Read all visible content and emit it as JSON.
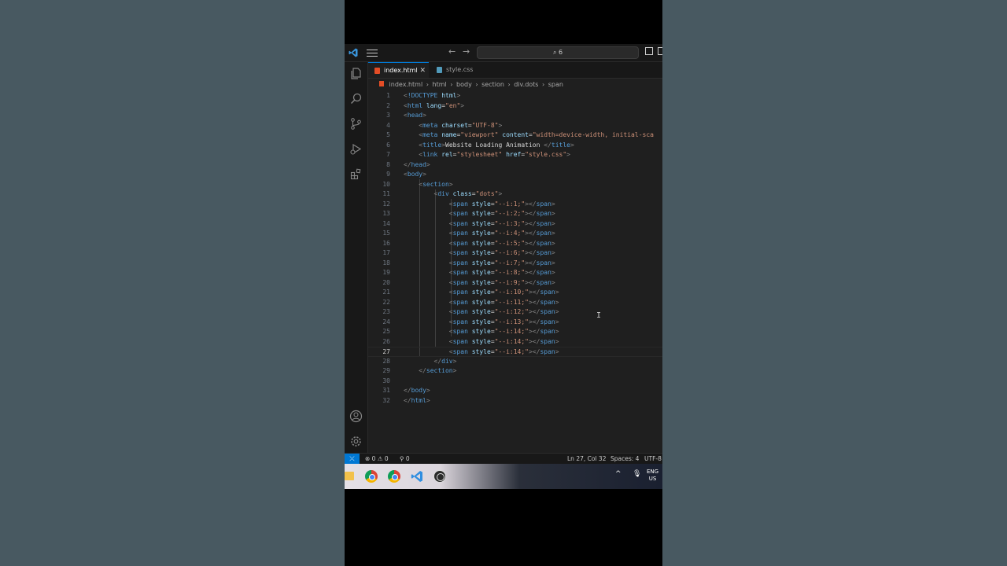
{
  "titlebar": {
    "search_text": "⌕ 6",
    "back_icon": "arrow-left-icon",
    "forward_icon": "arrow-right-icon"
  },
  "tabs": [
    {
      "label": "index.html",
      "active": true,
      "icon": "html5-icon",
      "icon_color": "#e44d26"
    },
    {
      "label": "style.css",
      "active": false,
      "icon": "css3-icon",
      "icon_color": "#519aba"
    }
  ],
  "breadcrumb": [
    "index.html",
    "html",
    "body",
    "section",
    "div.dots",
    "span"
  ],
  "editor": {
    "lines": [
      {
        "n": "1",
        "tokens": [
          [
            "t-punct",
            "<"
          ],
          [
            "t-doc",
            "!DOCTYPE"
          ],
          [
            "t-text",
            " "
          ],
          [
            "t-attr",
            "html"
          ],
          [
            "t-punct",
            ">"
          ]
        ]
      },
      {
        "n": "2",
        "tokens": [
          [
            "t-punct",
            "<"
          ],
          [
            "t-tag",
            "html"
          ],
          [
            "t-text",
            " "
          ],
          [
            "t-attr",
            "lang"
          ],
          [
            "t-text",
            "="
          ],
          [
            "t-str",
            "\"en\""
          ],
          [
            "t-punct",
            ">"
          ]
        ]
      },
      {
        "n": "3",
        "tokens": [
          [
            "t-punct",
            "<"
          ],
          [
            "t-tag",
            "head"
          ],
          [
            "t-punct",
            ">"
          ]
        ]
      },
      {
        "n": "4",
        "tokens": [
          [
            "t-text",
            "    "
          ],
          [
            "t-punct",
            "<"
          ],
          [
            "t-tag",
            "meta"
          ],
          [
            "t-text",
            " "
          ],
          [
            "t-attr",
            "charset"
          ],
          [
            "t-text",
            "="
          ],
          [
            "t-str",
            "\"UTF-8\""
          ],
          [
            "t-punct",
            ">"
          ]
        ]
      },
      {
        "n": "5",
        "tokens": [
          [
            "t-text",
            "    "
          ],
          [
            "t-punct",
            "<"
          ],
          [
            "t-tag",
            "meta"
          ],
          [
            "t-text",
            " "
          ],
          [
            "t-attr",
            "name"
          ],
          [
            "t-text",
            "="
          ],
          [
            "t-str",
            "\"viewport\""
          ],
          [
            "t-text",
            " "
          ],
          [
            "t-attr",
            "content"
          ],
          [
            "t-text",
            "="
          ],
          [
            "t-str",
            "\"width=device-width, initial-sca"
          ]
        ]
      },
      {
        "n": "6",
        "tokens": [
          [
            "t-text",
            "    "
          ],
          [
            "t-punct",
            "<"
          ],
          [
            "t-tag",
            "title"
          ],
          [
            "t-punct",
            ">"
          ],
          [
            "t-text",
            "Website Loading Animation "
          ],
          [
            "t-punct",
            "</"
          ],
          [
            "t-tag",
            "title"
          ],
          [
            "t-punct",
            ">"
          ]
        ]
      },
      {
        "n": "7",
        "tokens": [
          [
            "t-text",
            "    "
          ],
          [
            "t-punct",
            "<"
          ],
          [
            "t-tag",
            "link"
          ],
          [
            "t-text",
            " "
          ],
          [
            "t-attr",
            "rel"
          ],
          [
            "t-text",
            "="
          ],
          [
            "t-str",
            "\"stylesheet\""
          ],
          [
            "t-text",
            " "
          ],
          [
            "t-attr",
            "href"
          ],
          [
            "t-text",
            "="
          ],
          [
            "t-str",
            "\"style.css\""
          ],
          [
            "t-punct",
            ">"
          ]
        ]
      },
      {
        "n": "8",
        "tokens": [
          [
            "t-punct",
            "</"
          ],
          [
            "t-tag",
            "head"
          ],
          [
            "t-punct",
            ">"
          ]
        ]
      },
      {
        "n": "9",
        "tokens": [
          [
            "t-punct",
            "<"
          ],
          [
            "t-tag",
            "body"
          ],
          [
            "t-punct",
            ">"
          ]
        ]
      },
      {
        "n": "10",
        "tokens": [
          [
            "t-text",
            "    "
          ],
          [
            "t-punct",
            "<"
          ],
          [
            "t-tag",
            "section"
          ],
          [
            "t-punct",
            ">"
          ]
        ]
      },
      {
        "n": "11",
        "tokens": [
          [
            "t-text",
            "        "
          ],
          [
            "t-punct",
            "<"
          ],
          [
            "t-tag",
            "div"
          ],
          [
            "t-text",
            " "
          ],
          [
            "t-attr",
            "class"
          ],
          [
            "t-text",
            "="
          ],
          [
            "t-str",
            "\"dots\""
          ],
          [
            "t-punct",
            ">"
          ]
        ]
      },
      {
        "n": "12",
        "tokens": [
          [
            "t-text",
            "            "
          ],
          [
            "t-punct",
            "<"
          ],
          [
            "t-tag",
            "span"
          ],
          [
            "t-text",
            " "
          ],
          [
            "t-attr",
            "style"
          ],
          [
            "t-text",
            "="
          ],
          [
            "t-str",
            "\"--i:1;\""
          ],
          [
            "t-punct",
            "></"
          ],
          [
            "t-tag",
            "span"
          ],
          [
            "t-punct",
            ">"
          ]
        ]
      },
      {
        "n": "13",
        "tokens": [
          [
            "t-text",
            "            "
          ],
          [
            "t-punct",
            "<"
          ],
          [
            "t-tag",
            "span"
          ],
          [
            "t-text",
            " "
          ],
          [
            "t-attr",
            "style"
          ],
          [
            "t-text",
            "="
          ],
          [
            "t-str",
            "\"--i:2;\""
          ],
          [
            "t-punct",
            "></"
          ],
          [
            "t-tag",
            "span"
          ],
          [
            "t-punct",
            ">"
          ]
        ]
      },
      {
        "n": "14",
        "tokens": [
          [
            "t-text",
            "            "
          ],
          [
            "t-punct",
            "<"
          ],
          [
            "t-tag",
            "span"
          ],
          [
            "t-text",
            " "
          ],
          [
            "t-attr",
            "style"
          ],
          [
            "t-text",
            "="
          ],
          [
            "t-str",
            "\"--i:3;\""
          ],
          [
            "t-punct",
            "></"
          ],
          [
            "t-tag",
            "span"
          ],
          [
            "t-punct",
            ">"
          ]
        ]
      },
      {
        "n": "15",
        "tokens": [
          [
            "t-text",
            "            "
          ],
          [
            "t-punct",
            "<"
          ],
          [
            "t-tag",
            "span"
          ],
          [
            "t-text",
            " "
          ],
          [
            "t-attr",
            "style"
          ],
          [
            "t-text",
            "="
          ],
          [
            "t-str",
            "\"--i:4;\""
          ],
          [
            "t-punct",
            "></"
          ],
          [
            "t-tag",
            "span"
          ],
          [
            "t-punct",
            ">"
          ]
        ]
      },
      {
        "n": "16",
        "tokens": [
          [
            "t-text",
            "            "
          ],
          [
            "t-punct",
            "<"
          ],
          [
            "t-tag",
            "span"
          ],
          [
            "t-text",
            " "
          ],
          [
            "t-attr",
            "style"
          ],
          [
            "t-text",
            "="
          ],
          [
            "t-str",
            "\"--i:5;\""
          ],
          [
            "t-punct",
            "></"
          ],
          [
            "t-tag",
            "span"
          ],
          [
            "t-punct",
            ">"
          ]
        ]
      },
      {
        "n": "17",
        "tokens": [
          [
            "t-text",
            "            "
          ],
          [
            "t-punct",
            "<"
          ],
          [
            "t-tag",
            "span"
          ],
          [
            "t-text",
            " "
          ],
          [
            "t-attr",
            "style"
          ],
          [
            "t-text",
            "="
          ],
          [
            "t-str",
            "\"--i:6;\""
          ],
          [
            "t-punct",
            "></"
          ],
          [
            "t-tag",
            "span"
          ],
          [
            "t-punct",
            ">"
          ]
        ]
      },
      {
        "n": "18",
        "tokens": [
          [
            "t-text",
            "            "
          ],
          [
            "t-punct",
            "<"
          ],
          [
            "t-tag",
            "span"
          ],
          [
            "t-text",
            " "
          ],
          [
            "t-attr",
            "style"
          ],
          [
            "t-text",
            "="
          ],
          [
            "t-str",
            "\"--i:7;\""
          ],
          [
            "t-punct",
            "></"
          ],
          [
            "t-tag",
            "span"
          ],
          [
            "t-punct",
            ">"
          ]
        ]
      },
      {
        "n": "19",
        "tokens": [
          [
            "t-text",
            "            "
          ],
          [
            "t-punct",
            "<"
          ],
          [
            "t-tag",
            "span"
          ],
          [
            "t-text",
            " "
          ],
          [
            "t-attr",
            "style"
          ],
          [
            "t-text",
            "="
          ],
          [
            "t-str",
            "\"--i:8;\""
          ],
          [
            "t-punct",
            "></"
          ],
          [
            "t-tag",
            "span"
          ],
          [
            "t-punct",
            ">"
          ]
        ]
      },
      {
        "n": "20",
        "tokens": [
          [
            "t-text",
            "            "
          ],
          [
            "t-punct",
            "<"
          ],
          [
            "t-tag",
            "span"
          ],
          [
            "t-text",
            " "
          ],
          [
            "t-attr",
            "style"
          ],
          [
            "t-text",
            "="
          ],
          [
            "t-str",
            "\"--i:9;\""
          ],
          [
            "t-punct",
            "></"
          ],
          [
            "t-tag",
            "span"
          ],
          [
            "t-punct",
            ">"
          ]
        ]
      },
      {
        "n": "21",
        "tokens": [
          [
            "t-text",
            "            "
          ],
          [
            "t-punct",
            "<"
          ],
          [
            "t-tag",
            "span"
          ],
          [
            "t-text",
            " "
          ],
          [
            "t-attr",
            "style"
          ],
          [
            "t-text",
            "="
          ],
          [
            "t-str",
            "\"--i:10;\""
          ],
          [
            "t-punct",
            "></"
          ],
          [
            "t-tag",
            "span"
          ],
          [
            "t-punct",
            ">"
          ]
        ]
      },
      {
        "n": "22",
        "tokens": [
          [
            "t-text",
            "            "
          ],
          [
            "t-punct",
            "<"
          ],
          [
            "t-tag",
            "span"
          ],
          [
            "t-text",
            " "
          ],
          [
            "t-attr",
            "style"
          ],
          [
            "t-text",
            "="
          ],
          [
            "t-str",
            "\"--i:11;\""
          ],
          [
            "t-punct",
            "></"
          ],
          [
            "t-tag",
            "span"
          ],
          [
            "t-punct",
            ">"
          ]
        ]
      },
      {
        "n": "23",
        "tokens": [
          [
            "t-text",
            "            "
          ],
          [
            "t-punct",
            "<"
          ],
          [
            "t-tag",
            "span"
          ],
          [
            "t-text",
            " "
          ],
          [
            "t-attr",
            "style"
          ],
          [
            "t-text",
            "="
          ],
          [
            "t-str",
            "\"--i:12;\""
          ],
          [
            "t-punct",
            "></"
          ],
          [
            "t-tag",
            "span"
          ],
          [
            "t-punct",
            ">"
          ]
        ]
      },
      {
        "n": "24",
        "tokens": [
          [
            "t-text",
            "            "
          ],
          [
            "t-punct",
            "<"
          ],
          [
            "t-tag",
            "span"
          ],
          [
            "t-text",
            " "
          ],
          [
            "t-attr",
            "style"
          ],
          [
            "t-text",
            "="
          ],
          [
            "t-str",
            "\"--i:13;\""
          ],
          [
            "t-punct",
            "></"
          ],
          [
            "t-tag",
            "span"
          ],
          [
            "t-punct",
            ">"
          ]
        ]
      },
      {
        "n": "25",
        "tokens": [
          [
            "t-text",
            "            "
          ],
          [
            "t-punct",
            "<"
          ],
          [
            "t-tag",
            "span"
          ],
          [
            "t-text",
            " "
          ],
          [
            "t-attr",
            "style"
          ],
          [
            "t-text",
            "="
          ],
          [
            "t-str",
            "\"--i:14;\""
          ],
          [
            "t-punct",
            "></"
          ],
          [
            "t-tag",
            "span"
          ],
          [
            "t-punct",
            ">"
          ]
        ]
      },
      {
        "n": "26",
        "tokens": [
          [
            "t-text",
            "            "
          ],
          [
            "t-punct",
            "<"
          ],
          [
            "t-tag",
            "span"
          ],
          [
            "t-text",
            " "
          ],
          [
            "t-attr",
            "style"
          ],
          [
            "t-text",
            "="
          ],
          [
            "t-str",
            "\"--i:14;\""
          ],
          [
            "t-punct",
            "></"
          ],
          [
            "t-tag",
            "span"
          ],
          [
            "t-punct",
            ">"
          ]
        ]
      },
      {
        "n": "27",
        "tokens": [
          [
            "t-text",
            "            "
          ],
          [
            "t-punct",
            "<"
          ],
          [
            "t-tag",
            "span"
          ],
          [
            "t-text",
            " "
          ],
          [
            "t-attr",
            "style"
          ],
          [
            "t-text",
            "="
          ],
          [
            "t-str",
            "\"--i:14;\""
          ],
          [
            "t-punct",
            "></"
          ],
          [
            "t-tag",
            "span"
          ],
          [
            "t-punct",
            ">"
          ]
        ],
        "current": true
      },
      {
        "n": "28",
        "tokens": [
          [
            "t-text",
            "        "
          ],
          [
            "t-punct",
            "</"
          ],
          [
            "t-tag",
            "div"
          ],
          [
            "t-punct",
            ">"
          ]
        ]
      },
      {
        "n": "29",
        "tokens": [
          [
            "t-text",
            "    "
          ],
          [
            "t-punct",
            "</"
          ],
          [
            "t-tag",
            "section"
          ],
          [
            "t-punct",
            ">"
          ]
        ]
      },
      {
        "n": "30",
        "tokens": []
      },
      {
        "n": "31",
        "tokens": [
          [
            "t-punct",
            "</"
          ],
          [
            "t-tag",
            "body"
          ],
          [
            "t-punct",
            ">"
          ]
        ]
      },
      {
        "n": "32",
        "tokens": [
          [
            "t-punct",
            "</"
          ],
          [
            "t-tag",
            "html"
          ],
          [
            "t-punct",
            ">"
          ]
        ]
      }
    ]
  },
  "activitybar": {
    "icons": [
      "explorer-icon",
      "search-icon",
      "source-control-icon",
      "run-debug-icon",
      "extensions-icon"
    ],
    "bottom_icons": [
      "account-icon",
      "settings-gear-icon"
    ]
  },
  "statusbar": {
    "remote_label": "⤫",
    "problems": "⊗ 0 ⚠ 0",
    "ports": "⚲ 0",
    "cursor_pos": "Ln 27, Col 32",
    "spaces": "Spaces: 4",
    "encoding": "UTF-8"
  },
  "taskbar": {
    "apps": [
      "file-explorer-icon",
      "chrome-icon",
      "chrome-canary-icon",
      "vscode-icon",
      "obs-icon"
    ],
    "lang_line1": "ENG",
    "lang_line2": "US"
  }
}
